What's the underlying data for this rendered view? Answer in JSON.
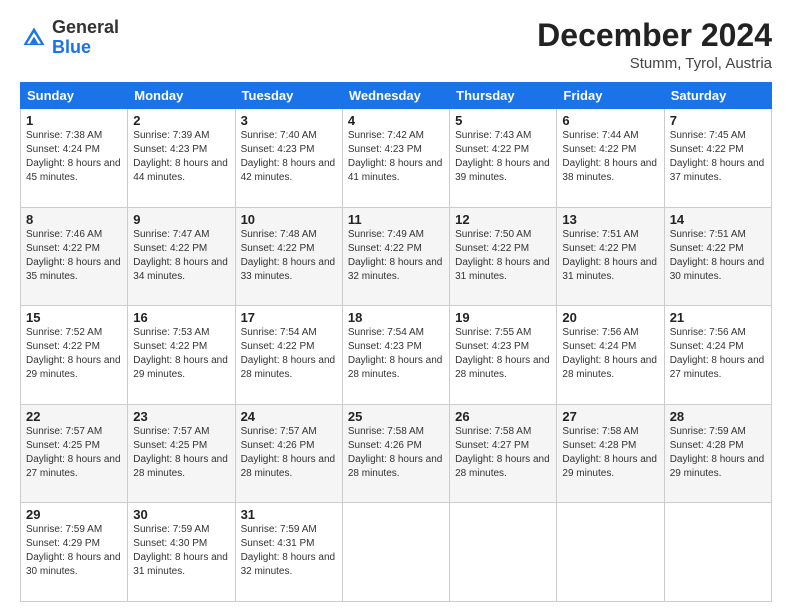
{
  "header": {
    "logo_general": "General",
    "logo_blue": "Blue",
    "month_year": "December 2024",
    "location": "Stumm, Tyrol, Austria"
  },
  "days_of_week": [
    "Sunday",
    "Monday",
    "Tuesday",
    "Wednesday",
    "Thursday",
    "Friday",
    "Saturday"
  ],
  "weeks": [
    [
      {
        "day": "1",
        "sunrise": "7:38 AM",
        "sunset": "4:24 PM",
        "daylight": "8 hours and 45 minutes."
      },
      {
        "day": "2",
        "sunrise": "7:39 AM",
        "sunset": "4:23 PM",
        "daylight": "8 hours and 44 minutes."
      },
      {
        "day": "3",
        "sunrise": "7:40 AM",
        "sunset": "4:23 PM",
        "daylight": "8 hours and 42 minutes."
      },
      {
        "day": "4",
        "sunrise": "7:42 AM",
        "sunset": "4:23 PM",
        "daylight": "8 hours and 41 minutes."
      },
      {
        "day": "5",
        "sunrise": "7:43 AM",
        "sunset": "4:22 PM",
        "daylight": "8 hours and 39 minutes."
      },
      {
        "day": "6",
        "sunrise": "7:44 AM",
        "sunset": "4:22 PM",
        "daylight": "8 hours and 38 minutes."
      },
      {
        "day": "7",
        "sunrise": "7:45 AM",
        "sunset": "4:22 PM",
        "daylight": "8 hours and 37 minutes."
      }
    ],
    [
      {
        "day": "8",
        "sunrise": "7:46 AM",
        "sunset": "4:22 PM",
        "daylight": "8 hours and 35 minutes."
      },
      {
        "day": "9",
        "sunrise": "7:47 AM",
        "sunset": "4:22 PM",
        "daylight": "8 hours and 34 minutes."
      },
      {
        "day": "10",
        "sunrise": "7:48 AM",
        "sunset": "4:22 PM",
        "daylight": "8 hours and 33 minutes."
      },
      {
        "day": "11",
        "sunrise": "7:49 AM",
        "sunset": "4:22 PM",
        "daylight": "8 hours and 32 minutes."
      },
      {
        "day": "12",
        "sunrise": "7:50 AM",
        "sunset": "4:22 PM",
        "daylight": "8 hours and 31 minutes."
      },
      {
        "day": "13",
        "sunrise": "7:51 AM",
        "sunset": "4:22 PM",
        "daylight": "8 hours and 31 minutes."
      },
      {
        "day": "14",
        "sunrise": "7:51 AM",
        "sunset": "4:22 PM",
        "daylight": "8 hours and 30 minutes."
      }
    ],
    [
      {
        "day": "15",
        "sunrise": "7:52 AM",
        "sunset": "4:22 PM",
        "daylight": "8 hours and 29 minutes."
      },
      {
        "day": "16",
        "sunrise": "7:53 AM",
        "sunset": "4:22 PM",
        "daylight": "8 hours and 29 minutes."
      },
      {
        "day": "17",
        "sunrise": "7:54 AM",
        "sunset": "4:22 PM",
        "daylight": "8 hours and 28 minutes."
      },
      {
        "day": "18",
        "sunrise": "7:54 AM",
        "sunset": "4:23 PM",
        "daylight": "8 hours and 28 minutes."
      },
      {
        "day": "19",
        "sunrise": "7:55 AM",
        "sunset": "4:23 PM",
        "daylight": "8 hours and 28 minutes."
      },
      {
        "day": "20",
        "sunrise": "7:56 AM",
        "sunset": "4:24 PM",
        "daylight": "8 hours and 28 minutes."
      },
      {
        "day": "21",
        "sunrise": "7:56 AM",
        "sunset": "4:24 PM",
        "daylight": "8 hours and 27 minutes."
      }
    ],
    [
      {
        "day": "22",
        "sunrise": "7:57 AM",
        "sunset": "4:25 PM",
        "daylight": "8 hours and 27 minutes."
      },
      {
        "day": "23",
        "sunrise": "7:57 AM",
        "sunset": "4:25 PM",
        "daylight": "8 hours and 28 minutes."
      },
      {
        "day": "24",
        "sunrise": "7:57 AM",
        "sunset": "4:26 PM",
        "daylight": "8 hours and 28 minutes."
      },
      {
        "day": "25",
        "sunrise": "7:58 AM",
        "sunset": "4:26 PM",
        "daylight": "8 hours and 28 minutes."
      },
      {
        "day": "26",
        "sunrise": "7:58 AM",
        "sunset": "4:27 PM",
        "daylight": "8 hours and 28 minutes."
      },
      {
        "day": "27",
        "sunrise": "7:58 AM",
        "sunset": "4:28 PM",
        "daylight": "8 hours and 29 minutes."
      },
      {
        "day": "28",
        "sunrise": "7:59 AM",
        "sunset": "4:28 PM",
        "daylight": "8 hours and 29 minutes."
      }
    ],
    [
      {
        "day": "29",
        "sunrise": "7:59 AM",
        "sunset": "4:29 PM",
        "daylight": "8 hours and 30 minutes."
      },
      {
        "day": "30",
        "sunrise": "7:59 AM",
        "sunset": "4:30 PM",
        "daylight": "8 hours and 31 minutes."
      },
      {
        "day": "31",
        "sunrise": "7:59 AM",
        "sunset": "4:31 PM",
        "daylight": "8 hours and 32 minutes."
      },
      null,
      null,
      null,
      null
    ]
  ]
}
